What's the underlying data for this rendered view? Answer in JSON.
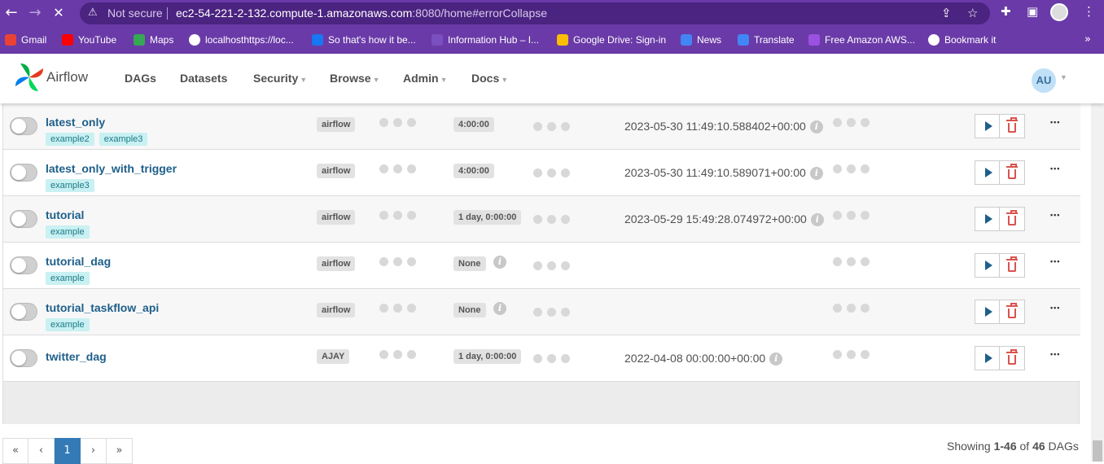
{
  "browser": {
    "omnibox": {
      "security": "Not secure",
      "host": "ec2-54-221-2-132.compute-1.amazonaws.com",
      "rest": ":8080/home#errorCollapse"
    },
    "bookmarks": [
      {
        "label": "Gmail",
        "icon": "gmail-icon",
        "color": "#ea4335"
      },
      {
        "label": "YouTube",
        "icon": "youtube-icon",
        "color": "#ff0000"
      },
      {
        "label": "Maps",
        "icon": "maps-icon",
        "color": "#34a853"
      },
      {
        "label": "localhosthttps://loc...",
        "icon": "globe-icon",
        "color": "#ffffff"
      },
      {
        "label": "So that's how it be...",
        "icon": "facebook-icon",
        "color": "#1877f2"
      },
      {
        "label": "Information Hub – I...",
        "icon": "info-hub-icon",
        "color": "#7a4fbf"
      },
      {
        "label": "Google Drive: Sign-in",
        "icon": "drive-icon",
        "color": "#fbbc04"
      },
      {
        "label": "News",
        "icon": "news-icon",
        "color": "#4285f4"
      },
      {
        "label": "Translate",
        "icon": "translate-icon",
        "color": "#4285f4"
      },
      {
        "label": "Free Amazon AWS...",
        "icon": "aws-icon",
        "color": "#9b51e0"
      },
      {
        "label": "Bookmark it",
        "icon": "globe-icon",
        "color": "#ffffff"
      }
    ]
  },
  "navbar": {
    "brand": "Airflow",
    "menu": [
      {
        "label": "DAGs",
        "dropdown": false
      },
      {
        "label": "Datasets",
        "dropdown": false
      },
      {
        "label": "Security",
        "dropdown": true
      },
      {
        "label": "Browse",
        "dropdown": true
      },
      {
        "label": "Admin",
        "dropdown": true
      },
      {
        "label": "Docs",
        "dropdown": true
      }
    ],
    "user_initials": "AU"
  },
  "dags": [
    {
      "name": "latest_only",
      "tags": [
        "example2",
        "example3"
      ],
      "owner": "airflow",
      "schedule": "4:00:00",
      "schedule_info": false,
      "last_run": "2023-05-30 11:49:10.588402+00:00"
    },
    {
      "name": "latest_only_with_trigger",
      "tags": [
        "example3"
      ],
      "owner": "airflow",
      "schedule": "4:00:00",
      "schedule_info": false,
      "last_run": "2023-05-30 11:49:10.589071+00:00"
    },
    {
      "name": "tutorial",
      "tags": [
        "example"
      ],
      "owner": "airflow",
      "schedule": "1 day, 0:00:00",
      "schedule_info": false,
      "last_run": "2023-05-29 15:49:28.074972+00:00"
    },
    {
      "name": "tutorial_dag",
      "tags": [
        "example"
      ],
      "owner": "airflow",
      "schedule": "None",
      "schedule_info": true,
      "last_run": ""
    },
    {
      "name": "tutorial_taskflow_api",
      "tags": [
        "example"
      ],
      "owner": "airflow",
      "schedule": "None",
      "schedule_info": true,
      "last_run": ""
    },
    {
      "name": "twitter_dag",
      "tags": [],
      "owner": "AJAY",
      "schedule": "1 day, 0:00:00",
      "schedule_info": false,
      "last_run": "2022-04-08 00:00:00+00:00"
    }
  ],
  "pagination": {
    "first": "«",
    "prev": "‹",
    "current": "1",
    "next": "›",
    "last": "»"
  },
  "summary": {
    "prefix": "Showing ",
    "range": "1-46",
    "of": " of ",
    "total": "46",
    "suffix": " DAGs"
  }
}
